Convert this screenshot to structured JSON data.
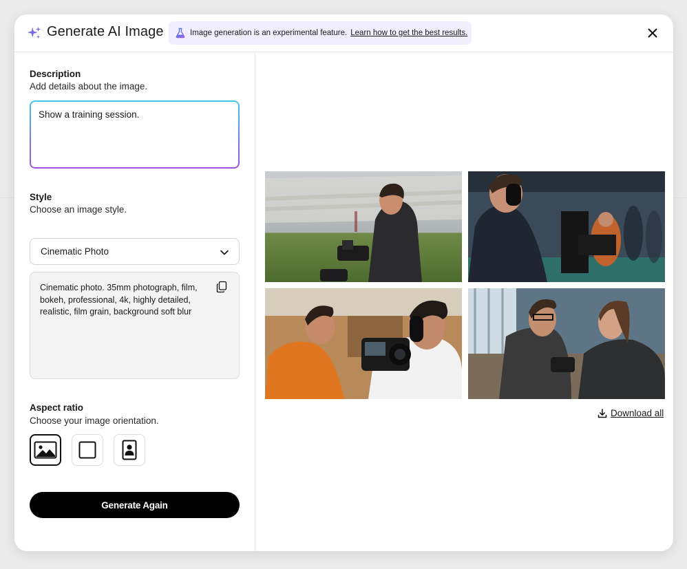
{
  "header": {
    "title": "Generate AI Image",
    "banner_text": "Image generation is an experimental feature.",
    "banner_link": "Learn how to get the best results."
  },
  "description": {
    "label": "Description",
    "helper": "Add details about the image.",
    "value": "Show a training session."
  },
  "style": {
    "label": "Style",
    "helper": "Choose an image style.",
    "selected": "Cinematic Photo",
    "prompt": "Cinematic photo. 35mm photograph, film, bokeh, professional, 4k, highly detailed, realistic, film grain, background soft blur"
  },
  "aspect_ratio": {
    "label": "Aspect ratio",
    "helper": "Choose your image orientation.",
    "options": [
      "landscape-icon",
      "square-icon",
      "portrait-icon"
    ],
    "selected": "landscape"
  },
  "actions": {
    "generate": "Generate Again",
    "download_all": "Download all"
  },
  "colors": {
    "accent_purple": "#9b52e0",
    "accent_cyan": "#3dc9e8",
    "banner_bg": "#f1effd",
    "button_bg": "#000000"
  }
}
